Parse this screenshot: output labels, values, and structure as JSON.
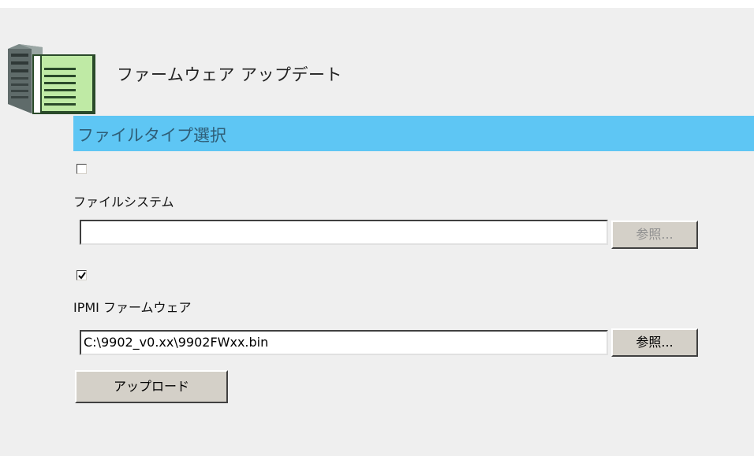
{
  "page": {
    "title": "ファームウェア アップデート",
    "icon": "server-document-icon"
  },
  "section": {
    "title": "ファイルタイプ選択"
  },
  "filesystem": {
    "checked": false,
    "label": "ファイルシステム",
    "path_value": "",
    "browse_label": "参照...",
    "browse_enabled": false
  },
  "ipmi": {
    "checked": true,
    "label": "IPMI ファームウェア",
    "path_value": "C:\\9902_v0.xx\\9902FWxx.bin",
    "browse_label": "参照...",
    "browse_enabled": true
  },
  "upload_label": "アップロード",
  "colors": {
    "panel_bg": "#efefef",
    "section_bar": "#5ec6f4",
    "section_text": "#2f5e77",
    "button_face": "#d4d0c8"
  }
}
